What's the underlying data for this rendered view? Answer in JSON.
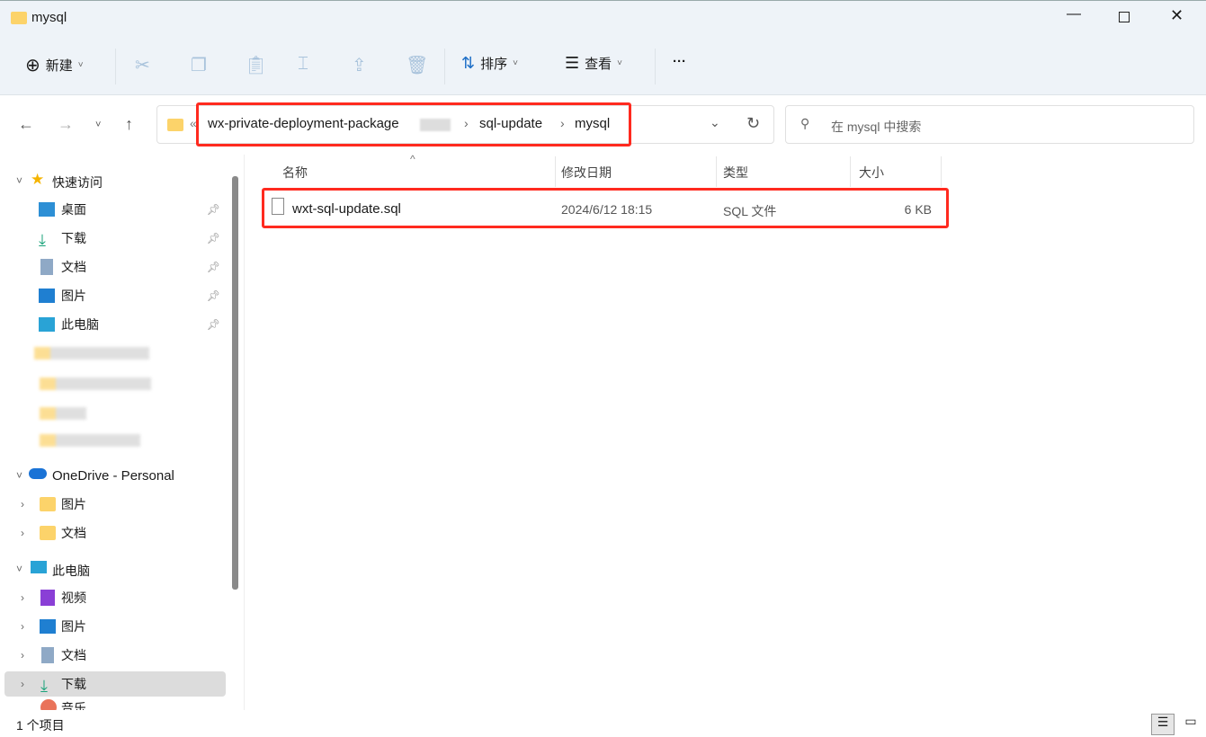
{
  "window": {
    "title": "mysql"
  },
  "toolbar": {
    "new_label": "新建",
    "sort_label": "排序",
    "view_label": "查看",
    "more": "···"
  },
  "address": {
    "truncation": "«",
    "segments": [
      "wx-private-deployment-package",
      "sql-update",
      "mysql"
    ],
    "separator": "›"
  },
  "search": {
    "placeholder": "在 mysql 中搜索"
  },
  "sidebar": {
    "quick_access": "快速访问",
    "quick_items": [
      "桌面",
      "下载",
      "文档",
      "图片",
      "此电脑"
    ],
    "onedrive": "OneDrive - Personal",
    "onedrive_items": [
      "图片",
      "文档"
    ],
    "this_pc": "此电脑",
    "pc_items": [
      "视频",
      "图片",
      "文档",
      "下载",
      "音乐"
    ]
  },
  "columns": {
    "name": "名称",
    "modified": "修改日期",
    "type": "类型",
    "size": "大小"
  },
  "files": [
    {
      "name": "wxt-sql-update.sql",
      "modified": "2024/6/12 18:15",
      "type": "SQL 文件",
      "size": "6 KB"
    }
  ],
  "status": {
    "count": "1 个项目"
  },
  "colors": {
    "highlight": "#ff2a1f",
    "chrome": "#eef3f8"
  }
}
